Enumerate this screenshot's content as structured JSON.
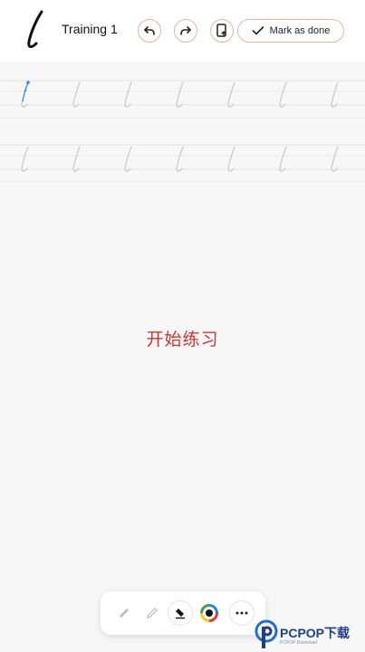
{
  "header": {
    "letter": "l",
    "title": "Training 1",
    "undo_icon": "undo-arrow-icon",
    "redo_icon": "redo-arrow-icon",
    "export_icon": "phone-export-icon",
    "done_label": "Mark as done"
  },
  "practice": {
    "rows": 2,
    "cells_per_row": 7,
    "guide_letter": "l"
  },
  "main": {
    "start_text": "开始练习"
  },
  "toolbar": {
    "tools": [
      "pencil-icon",
      "pencil-light-icon",
      "eraser-icon",
      "color-wheel-icon",
      "more-icon"
    ]
  },
  "watermark": {
    "text": "PCPOP下载",
    "sub": "PCPOP Download"
  },
  "colors": {
    "accent_border": "#e6b5a4",
    "start_text": "#d1342c",
    "guide_line": "#e3e3e3",
    "watermark": "#1f3f8c"
  }
}
